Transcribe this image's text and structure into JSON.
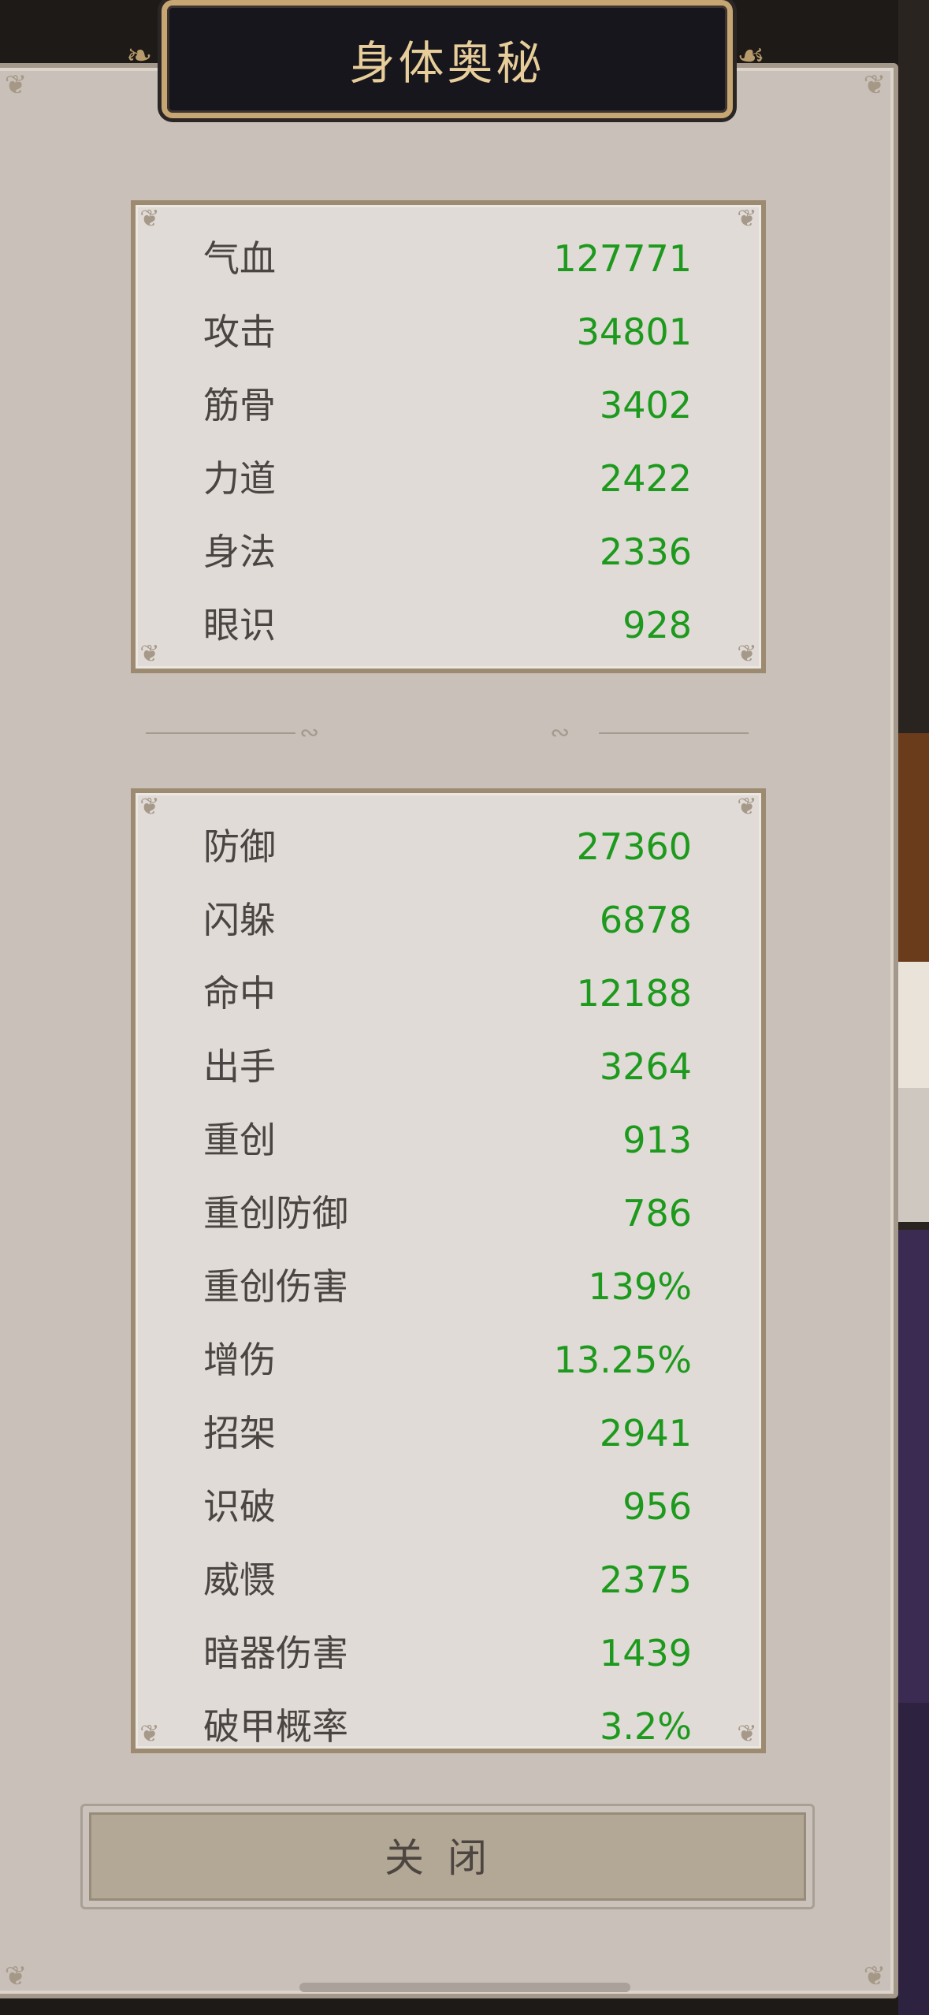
{
  "title": "身体奥秘",
  "primary_stats": [
    {
      "label": "气血",
      "value": "127771"
    },
    {
      "label": "攻击",
      "value": "34801"
    },
    {
      "label": "筋骨",
      "value": "3402"
    },
    {
      "label": "力道",
      "value": "2422"
    },
    {
      "label": "身法",
      "value": "2336"
    },
    {
      "label": "眼识",
      "value": "928"
    }
  ],
  "secondary_stats": [
    {
      "label": "防御",
      "value": "27360"
    },
    {
      "label": "闪躲",
      "value": "6878"
    },
    {
      "label": "命中",
      "value": "12188"
    },
    {
      "label": "出手",
      "value": "3264"
    },
    {
      "label": "重创",
      "value": "913"
    },
    {
      "label": "重创防御",
      "value": "786"
    },
    {
      "label": "重创伤害",
      "value": "139%"
    },
    {
      "label": "增伤",
      "value": "13.25%"
    },
    {
      "label": "招架",
      "value": "2941"
    },
    {
      "label": "识破",
      "value": "956"
    },
    {
      "label": "威慑",
      "value": "2375"
    },
    {
      "label": "暗器伤害",
      "value": "1439"
    },
    {
      "label": "破甲概率",
      "value": "3.2%"
    }
  ],
  "close_label": "关闭",
  "colors": {
    "value_green": "#1d9a1d",
    "label_dark": "#4a4442",
    "title_gold": "#e7cd9a",
    "panel": "#c9c0b9"
  }
}
